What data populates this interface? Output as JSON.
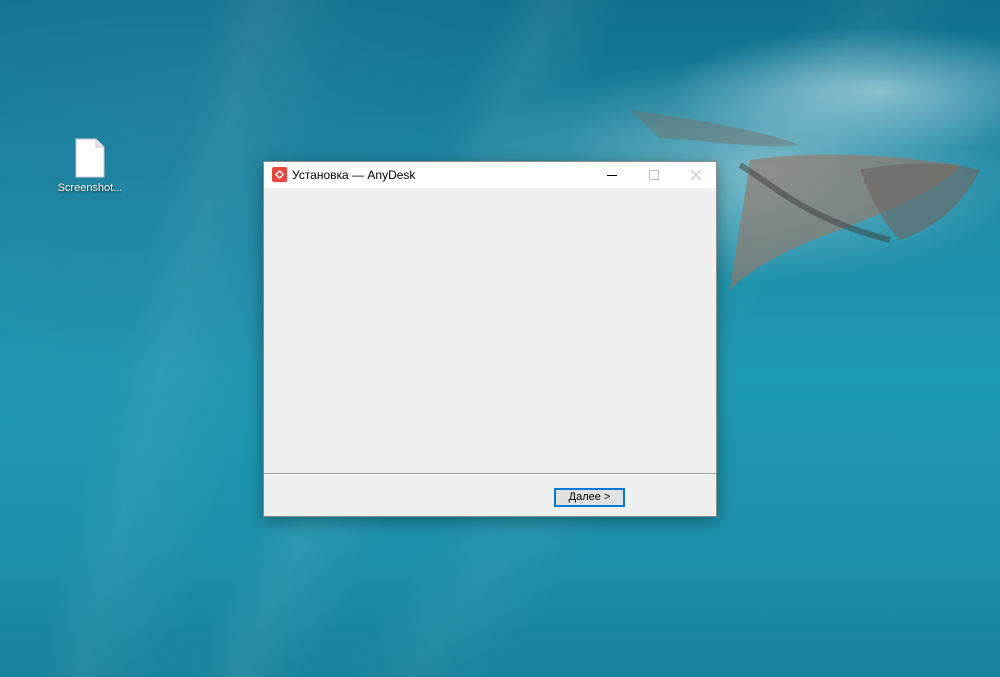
{
  "desktop": {
    "icons": [
      {
        "label": "Screenshot...",
        "icon": "file-icon"
      }
    ]
  },
  "window": {
    "title": "Установка — AnyDesk",
    "app_icon": "anydesk-icon",
    "controls": {
      "minimize": "minimize-icon",
      "maximize": "maximize-icon",
      "close": "close-icon"
    },
    "footer": {
      "next_label": "Далее >"
    }
  },
  "colors": {
    "accent": "#0078d7",
    "anydesk_red": "#ef443b",
    "window_bg": "#f0f0f0",
    "titlebar_bg": "#ffffff"
  }
}
